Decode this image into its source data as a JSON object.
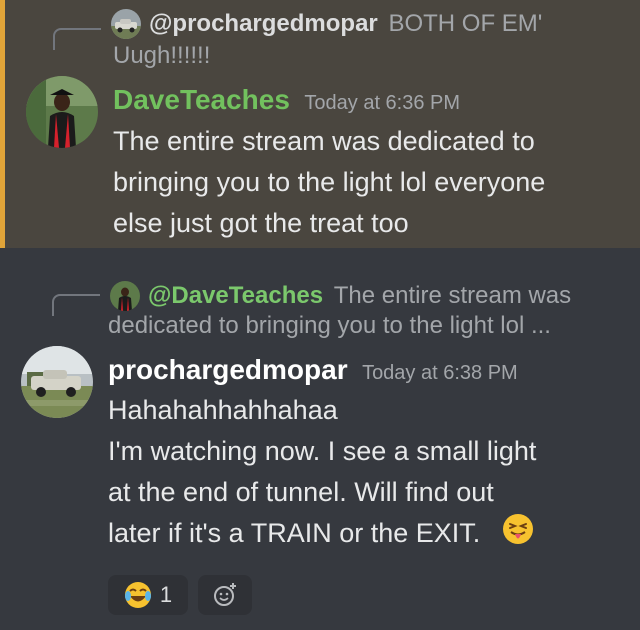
{
  "messages": [
    {
      "reply": {
        "author": "@prochargedmopar",
        "text_line1": "BOTH OF EM'",
        "text_line2": "Uugh!!!!!!"
      },
      "author": "DaveTeaches",
      "timestamp": "Today at 6:36 PM",
      "lines": [
        "The entire stream was dedicated to",
        "bringing you to the light lol everyone",
        "else just got the treat too"
      ]
    },
    {
      "reply": {
        "author": "@DaveTeaches",
        "text_line1": "The entire stream was",
        "text_line2": "dedicated to bringing you to the light lol ..."
      },
      "author": "prochargedmopar",
      "timestamp": "Today at 6:38 PM",
      "lines": [
        "Hahahahhahhahaa",
        "I'm watching now.  I see a small light",
        "at the end of tunnel.  Will find out",
        "later if it's a TRAIN or the EXIT."
      ],
      "reactions": [
        {
          "emoji": "joy-emoji",
          "count": "1"
        }
      ]
    }
  ],
  "colors": {
    "highlight_bg": "#4a463f",
    "highlight_border": "#e0a439",
    "main_bg": "#36393f",
    "green_name": "#72c15e"
  }
}
